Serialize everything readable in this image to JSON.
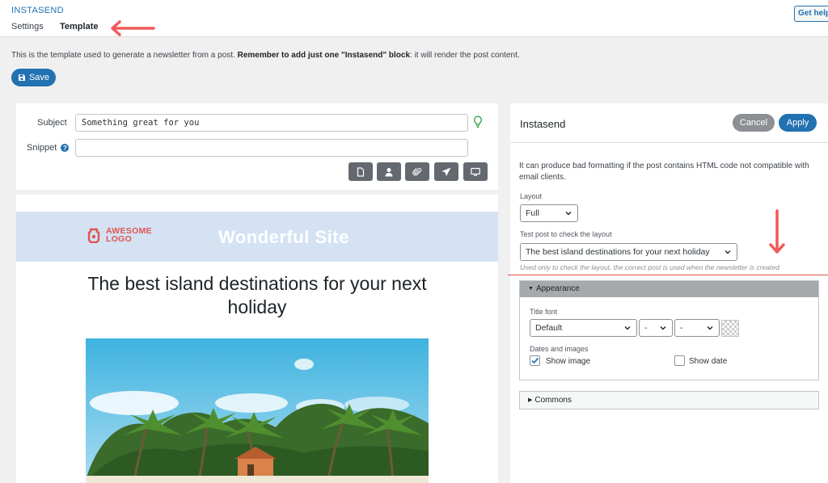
{
  "header": {
    "brand": "INSTASEND",
    "tabs": [
      {
        "label": "Settings",
        "active": false
      },
      {
        "label": "Template",
        "active": true
      }
    ],
    "help_label": "Get help"
  },
  "intro": {
    "text_before": "This is the template used to generate a newsletter from a post. ",
    "text_bold": "Remember to add just one \"Instasend\" block",
    "text_after": ": it will render the post content."
  },
  "save_label": "Save",
  "editor": {
    "subject_label": "Subject",
    "subject_value": "Something great for you",
    "snippet_label": "Snippet",
    "snippet_value": "",
    "toolbar_icons": [
      "document-icon",
      "user-icon",
      "paperclip-icon",
      "send-icon",
      "monitor-icon"
    ]
  },
  "preview": {
    "logo_line1": "AWESOME",
    "logo_line2": "LOGO",
    "site_title": "Wonderful Site",
    "post_title": "The best island destinations for your next holiday"
  },
  "sidepanel": {
    "title": "Instasend",
    "cancel_label": "Cancel",
    "apply_label": "Apply",
    "warning": "It can produce bad formatting if the post contains HTML code not compatible with email clients.",
    "layout_label": "Layout",
    "layout_value": "Full",
    "test_post_label": "Test post to check the layout",
    "test_post_value": "The best island destinations for your next holiday",
    "test_post_help": "Used only to check the layout, the correct post is used when the newsletter is created",
    "appearance": {
      "title": "Appearance",
      "title_font_label": "Title font",
      "font_family": "Default",
      "font_size": "-",
      "font_weight": "-",
      "dates_images_label": "Dates and images",
      "show_image_label": "Show image",
      "show_image_checked": true,
      "show_date_label": "Show date",
      "show_date_checked": false
    },
    "commons_title": "Commons"
  },
  "colors": {
    "accent": "#2271b1",
    "annotation": "#f15a5a",
    "logo": "#e05552",
    "header_band": "#d4e2f4"
  }
}
